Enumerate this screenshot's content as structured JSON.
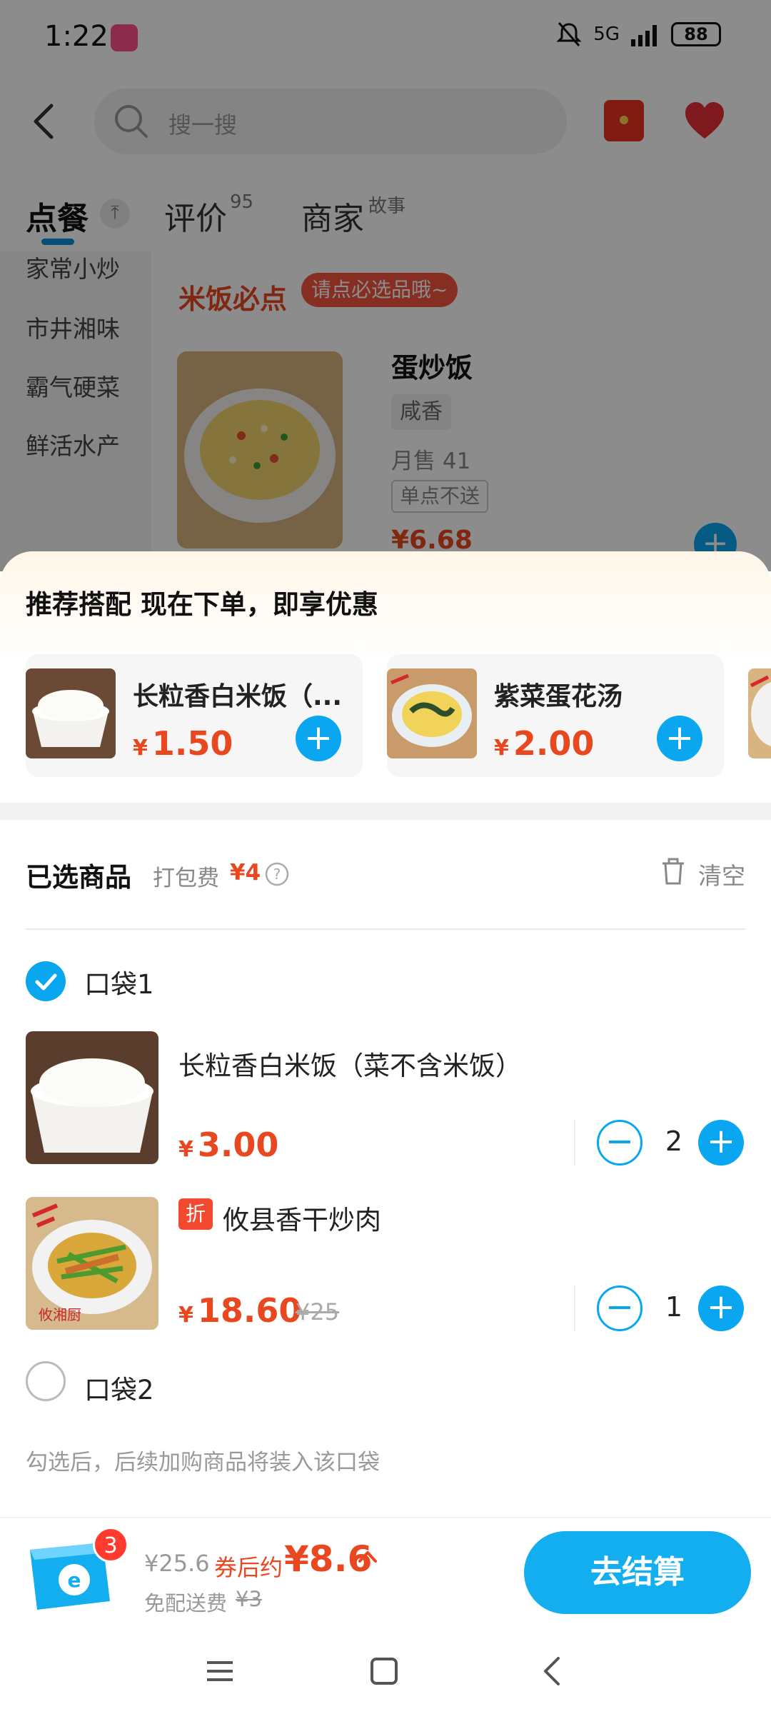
{
  "status_bar": {
    "time": "1:22",
    "network": "5G",
    "battery": "88"
  },
  "header": {
    "search_placeholder": "搜一搜"
  },
  "tabs": {
    "order": "点餐",
    "review": "评价",
    "review_count": "95",
    "store": "商家",
    "store_sub": "故事"
  },
  "sidebar": {
    "items": [
      "家常小炒",
      "市井湘味",
      "霸气硬菜",
      "鲜活水产"
    ]
  },
  "menu": {
    "section_title": "米饭必点",
    "section_tag": "请点必选品哦~",
    "dish": {
      "name": "蛋炒饭",
      "flavor": "咸香",
      "sales": "月售 41",
      "restriction": "单点不送",
      "price": "¥6.68"
    }
  },
  "recommend": {
    "title": "推荐搭配  现在下单，即享优惠",
    "items": [
      {
        "name": "长粒香白米饭（...",
        "currency": "¥",
        "price": "1.50"
      },
      {
        "name": "紫菜蛋花汤",
        "currency": "¥",
        "price": "2.00"
      }
    ]
  },
  "cart": {
    "title": "已选商品",
    "packing_label": "打包费",
    "packing_fee": "¥4",
    "clear": "清空",
    "bag1": "口袋1",
    "bag2": "口袋2",
    "bag_hint": "勾选后，后续加购商品将装入该口袋",
    "items": [
      {
        "name": "长粒香白米饭（菜不含米饭）",
        "currency": "¥",
        "price": "3.00",
        "qty": "2"
      },
      {
        "discount_tag": "折",
        "name": "攸县香干炒肉",
        "currency": "¥",
        "price": "18.60",
        "original_price": "¥25",
        "qty": "1"
      }
    ]
  },
  "checkout": {
    "badge": "3",
    "price_before": "¥25.6",
    "after_label": "券后约",
    "price_after": "¥8.6",
    "delivery": "免配送费",
    "delivery_original": "¥3",
    "button": "去结算"
  },
  "colors": {
    "accent": "#0aa7f0",
    "price": "#e8471f",
    "tag": "#f2553c"
  }
}
